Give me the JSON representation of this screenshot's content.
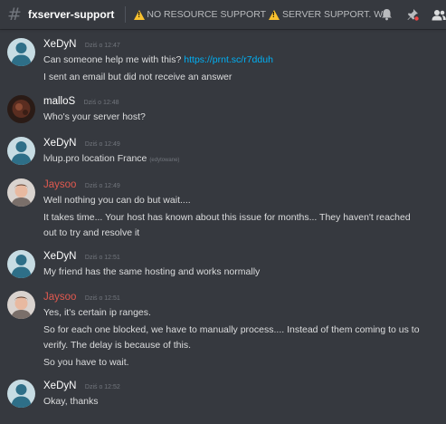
{
  "header": {
    "channel": "fxserver-support",
    "topic_part1": "NO RESOURCE SUPPORT",
    "topic_part2": "SERVER SUPPORT. We do not h..."
  },
  "colors": {
    "background": "#36393f",
    "link": "#00b0f4",
    "role_red": "#e0594f",
    "warning": "#f9c12e"
  },
  "icons": [
    "hash-icon",
    "warning-icon",
    "bell-icon",
    "pin-icon",
    "members-icon"
  ],
  "messages": [
    {
      "author": "XeDyN",
      "time": "Dziś o 12:47",
      "lines": [
        {
          "text": "Can someone help me with this?",
          "link": "https://prnt.sc/r7dduh"
        },
        {
          "text": "I sent an email but did not receive an answer"
        }
      ]
    },
    {
      "author": "malloS",
      "time": "Dziś o 12:48",
      "lines": [
        {
          "text": "Who's your server host?"
        }
      ]
    },
    {
      "author": "XeDyN",
      "time": "Dziś o 12:49",
      "lines": [
        {
          "text": "lvlup.pro location France",
          "edited": "(edytowane)"
        }
      ]
    },
    {
      "author": "Jaysoo",
      "time": "Dziś o 12:49",
      "lines": [
        {
          "text": "Well nothing you can do but wait...."
        },
        {
          "text": "It takes time... Your host has known about this issue for months... They haven't reached out to try and resolve it"
        }
      ]
    },
    {
      "author": "XeDyN",
      "time": "Dziś o 12:51",
      "lines": [
        {
          "text": "My friend has the same hosting and works normally"
        }
      ]
    },
    {
      "author": "Jaysoo",
      "time": "Dziś o 12:51",
      "lines": [
        {
          "text": "Yes, it's certain ip ranges."
        },
        {
          "text": "So for each one blocked, we have to manually process.... Instead of them coming to us to verify. The delay is because of this."
        },
        {
          "text": "So you have to wait."
        }
      ]
    },
    {
      "author": "XeDyN",
      "time": "Dziś o 12:52",
      "lines": [
        {
          "text": "Okay, thanks"
        }
      ]
    }
  ]
}
